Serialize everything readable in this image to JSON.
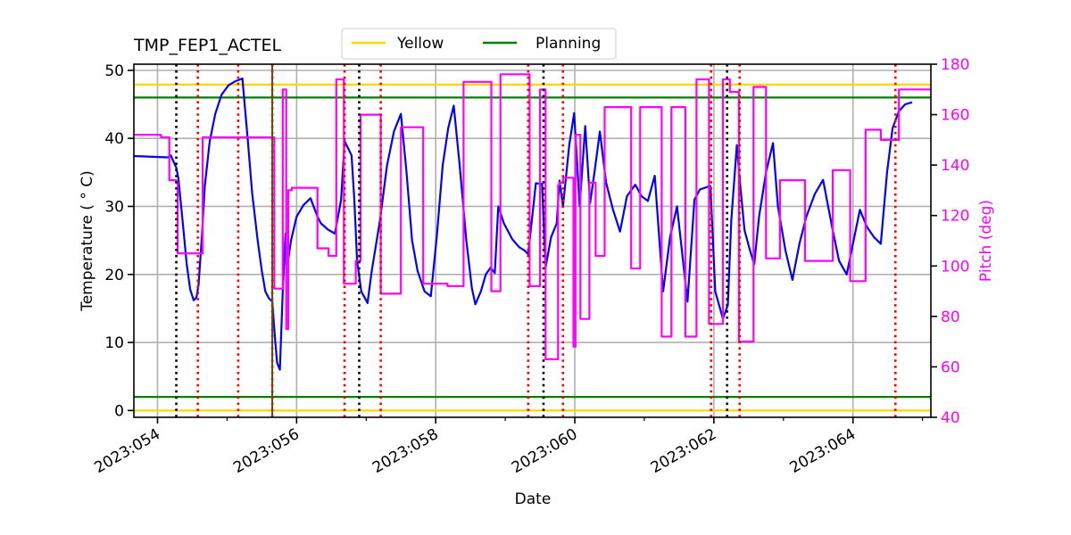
{
  "chart_data": {
    "type": "line",
    "title": "TMP_FEP1_ACTEL",
    "xlabel": "Date",
    "ylabel": "Temperature ( ° C)",
    "y2label": "Pitch (deg)",
    "xlim": [
      53.66,
      65.12
    ],
    "ylim": [
      -1.0,
      50.9
    ],
    "y2lim": [
      40,
      180
    ],
    "grid": true,
    "x_ticks": [
      {
        "value": 54,
        "label": "2023:054"
      },
      {
        "value": 56,
        "label": "2023:056"
      },
      {
        "value": 58,
        "label": "2023:058"
      },
      {
        "value": 60,
        "label": "2023:060"
      },
      {
        "value": 62,
        "label": "2023:062"
      },
      {
        "value": 64,
        "label": "2023:064"
      }
    ],
    "x_minor_ticks": [
      55,
      57,
      59,
      61,
      63,
      65
    ],
    "y_ticks": [
      {
        "value": 0,
        "label": "0"
      },
      {
        "value": 10,
        "label": "10"
      },
      {
        "value": 20,
        "label": "20"
      },
      {
        "value": 30,
        "label": "30"
      },
      {
        "value": 40,
        "label": "40"
      },
      {
        "value": 50,
        "label": "50"
      }
    ],
    "y2_ticks": [
      {
        "value": 40,
        "label": "40"
      },
      {
        "value": 60,
        "label": "60"
      },
      {
        "value": 80,
        "label": "80"
      },
      {
        "value": 100,
        "label": "100"
      },
      {
        "value": 120,
        "label": "120"
      },
      {
        "value": 140,
        "label": "140"
      },
      {
        "value": 160,
        "label": "160"
      },
      {
        "value": 180,
        "label": "180"
      }
    ],
    "legend": {
      "placement": "top-center",
      "entries": [
        {
          "label": "Yellow",
          "color": "#ffd700"
        },
        {
          "label": "Planning",
          "color": "#008000"
        }
      ]
    },
    "limits": [
      {
        "name": "yellow-high",
        "value": 47.9,
        "color": "#ffd700"
      },
      {
        "name": "planning-high",
        "value": 46.0,
        "color": "#008000"
      },
      {
        "name": "planning-low",
        "value": 2.0,
        "color": "#008000"
      },
      {
        "name": "yellow-low",
        "value": 0.0,
        "color": "#ffd700"
      }
    ],
    "vlines": [
      {
        "x": 54.27,
        "color": "#000000",
        "style": "dotted"
      },
      {
        "x": 54.58,
        "color": "#ff0000",
        "style": "dotted"
      },
      {
        "x": 55.16,
        "color": "#ff0000",
        "style": "dotted"
      },
      {
        "x": 55.65,
        "color": "#008000",
        "style": "solid"
      },
      {
        "x": 55.65,
        "color": "#ff0000",
        "style": "dotted"
      },
      {
        "x": 56.69,
        "color": "#ff0000",
        "style": "dotted"
      },
      {
        "x": 56.9,
        "color": "#000000",
        "style": "dotted"
      },
      {
        "x": 57.21,
        "color": "#ff0000",
        "style": "dotted"
      },
      {
        "x": 59.33,
        "color": "#ff0000",
        "style": "dotted"
      },
      {
        "x": 59.55,
        "color": "#000000",
        "style": "dotted"
      },
      {
        "x": 59.83,
        "color": "#ff0000",
        "style": "dotted"
      },
      {
        "x": 61.96,
        "color": "#ff0000",
        "style": "dotted"
      },
      {
        "x": 62.19,
        "color": "#000000",
        "style": "dotted"
      },
      {
        "x": 62.37,
        "color": "#ff0000",
        "style": "dotted"
      },
      {
        "x": 64.61,
        "color": "#ff0000",
        "style": "dotted"
      }
    ],
    "series": [
      {
        "name": "TMP_FEP1_ACTEL",
        "axis": "left",
        "color": "#0000ff",
        "x": [
          53.66,
          54.15,
          54.19,
          54.27,
          54.3,
          54.36,
          54.42,
          54.47,
          54.52,
          54.56,
          54.59,
          54.64,
          54.68,
          54.75,
          54.83,
          54.92,
          55.02,
          55.12,
          55.22,
          55.3,
          55.36,
          55.44,
          55.5,
          55.55,
          55.6,
          55.65,
          55.69,
          55.72,
          55.76,
          55.8,
          55.84,
          55.87,
          55.92,
          56.0,
          56.1,
          56.2,
          56.3,
          56.35,
          56.45,
          56.55,
          56.64,
          56.69,
          56.79,
          56.83,
          56.87,
          56.93,
          57.02,
          57.08,
          57.2,
          57.3,
          57.4,
          57.5,
          57.58,
          57.66,
          57.74,
          57.84,
          57.93,
          58.02,
          58.1,
          58.18,
          58.26,
          58.34,
          58.44,
          58.52,
          58.57,
          58.65,
          58.72,
          58.79,
          58.85,
          58.9,
          58.98,
          59.1,
          59.2,
          59.28,
          59.33,
          59.44,
          59.53,
          59.58,
          59.66,
          59.74,
          59.78,
          59.83,
          59.92,
          59.99,
          60.07,
          60.15,
          60.22,
          60.29,
          60.36,
          60.45,
          60.55,
          60.65,
          60.75,
          60.87,
          60.96,
          61.05,
          61.15,
          61.27,
          61.37,
          61.47,
          61.62,
          61.72,
          61.8,
          61.95,
          62.02,
          62.13,
          62.2,
          62.25,
          62.33,
          62.38,
          62.44,
          62.52,
          62.58,
          62.65,
          62.75,
          62.85,
          62.92,
          63.03,
          63.13,
          63.23,
          63.33,
          63.45,
          63.57,
          63.7,
          63.8,
          63.91,
          63.99,
          64.1,
          64.2,
          64.3,
          64.4,
          64.49,
          64.57,
          64.66,
          64.75,
          64.85,
          64.95,
          65.12
        ],
        "y": [
          37.4,
          37.2,
          37.5,
          35.7,
          34.1,
          28.0,
          21.5,
          17.8,
          16.2,
          16.6,
          18.5,
          26.0,
          33.0,
          39.5,
          43.6,
          46.4,
          47.8,
          48.4,
          48.8,
          39.5,
          32.0,
          25.0,
          20.5,
          17.5,
          16.5,
          16.0,
          10.5,
          7.0,
          6.0,
          17.5,
          26.0,
          21.5,
          25.0,
          28.5,
          30.2,
          31.2,
          28.5,
          27.5,
          26.6,
          26.0,
          31.0,
          39.6,
          37.5,
          31.0,
          22.0,
          17.5,
          15.8,
          20.5,
          28.0,
          36.0,
          41.0,
          43.6,
          35.0,
          25.0,
          20.5,
          17.5,
          16.8,
          26.0,
          36.0,
          41.5,
          44.8,
          36.5,
          25.0,
          18.0,
          15.6,
          17.5,
          20.0,
          21.0,
          20.2,
          30.0,
          27.5,
          25.2,
          24.0,
          23.5,
          23.0,
          33.4,
          33.3,
          21.0,
          25.5,
          27.5,
          33.8,
          30.0,
          39.0,
          43.7,
          30.0,
          41.8,
          30.5,
          35.5,
          41.0,
          33.5,
          29.5,
          26.3,
          31.5,
          33.2,
          31.5,
          30.8,
          34.5,
          17.5,
          25.5,
          30.0,
          16.0,
          31.0,
          32.5,
          33.0,
          17.5,
          13.5,
          15.5,
          28.0,
          39.0,
          33.0,
          26.5,
          23.5,
          21.5,
          28.5,
          35.0,
          39.3,
          30.0,
          23.5,
          19.2,
          24.5,
          28.5,
          31.8,
          33.9,
          27.0,
          22.0,
          20.0,
          24.0,
          29.5,
          27.0,
          25.5,
          24.5,
          35.0,
          41.5,
          44.0,
          45.0,
          45.3
        ]
      },
      {
        "name": "Pitch",
        "axis": "right",
        "color": "#ff00ff",
        "x": [
          53.66,
          54.05,
          54.05,
          54.17,
          54.17,
          54.27,
          54.27,
          54.29,
          54.29,
          54.65,
          54.65,
          55.68,
          55.68,
          55.8,
          55.8,
          55.85,
          55.85,
          55.88,
          55.88,
          55.93,
          55.93,
          56.3,
          56.3,
          56.46,
          56.46,
          56.57,
          56.57,
          56.68,
          56.68,
          56.85,
          56.85,
          56.92,
          56.92,
          57.21,
          57.21,
          57.5,
          57.5,
          57.82,
          57.82,
          58.17,
          58.17,
          58.24,
          58.24,
          58.4,
          58.4,
          58.8,
          58.8,
          58.93,
          58.93,
          59.35,
          59.35,
          59.5,
          59.5,
          59.58,
          59.58,
          59.76,
          59.76,
          59.78,
          59.78,
          59.83,
          59.83,
          59.98,
          59.98,
          60.01,
          60.01,
          60.08,
          60.08,
          60.21,
          60.21,
          60.3,
          60.3,
          60.43,
          60.43,
          60.81,
          60.81,
          60.94,
          60.94,
          61.25,
          61.25,
          61.39,
          61.39,
          61.59,
          61.59,
          61.75,
          61.75,
          61.93,
          61.93,
          62.13,
          62.13,
          62.23,
          62.23,
          62.36,
          62.36,
          62.57,
          62.57,
          62.75,
          62.75,
          62.95,
          62.95,
          63.31,
          63.31,
          63.71,
          63.71,
          63.96,
          63.96,
          64.18,
          64.18,
          64.4,
          64.4,
          64.66,
          64.66,
          65.12
        ],
        "y": [
          152,
          152,
          151,
          151,
          134,
          134,
          133,
          133,
          105,
          105,
          151,
          151,
          91,
          91,
          170,
          170,
          75,
          75,
          130,
          130,
          131,
          131,
          107,
          107,
          104,
          104,
          174,
          174,
          93,
          93,
          102,
          102,
          160,
          160,
          89,
          89,
          155,
          155,
          93,
          93,
          92,
          92,
          92,
          92,
          173,
          173,
          90,
          90,
          176,
          176,
          92,
          92,
          170,
          170,
          63,
          63,
          132,
          132,
          133,
          133,
          135,
          135,
          68,
          68,
          152,
          152,
          79,
          79,
          133,
          133,
          104,
          104,
          163,
          163,
          99,
          99,
          163,
          163,
          72,
          72,
          163,
          163,
          72,
          72,
          174,
          174,
          77,
          77,
          174,
          174,
          169,
          169,
          70,
          70,
          171,
          171,
          103,
          103,
          134,
          134,
          102,
          102,
          138,
          138,
          94,
          94,
          154,
          154,
          150,
          150,
          170,
          170,
          170
        ]
      }
    ]
  }
}
